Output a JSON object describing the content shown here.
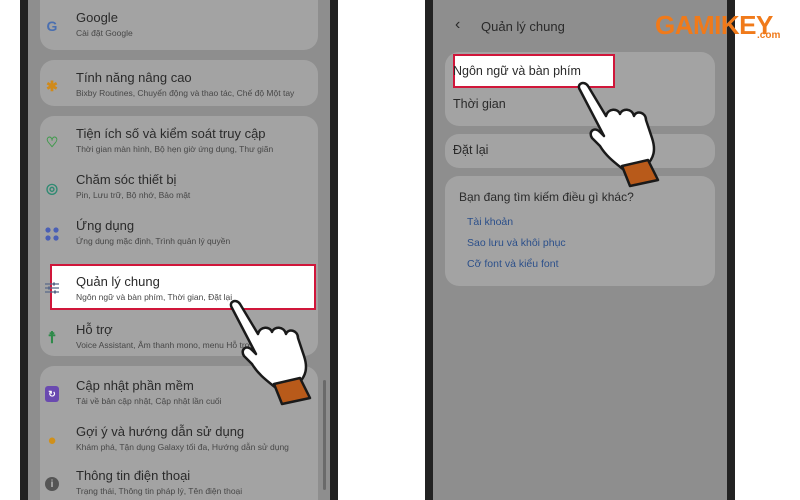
{
  "left_screen": {
    "items": [
      {
        "title": "Google",
        "sub": "Cài đặt Google",
        "icon": "google-icon",
        "color": "#4a6fb0"
      },
      {
        "title": "Tính năng nâng cao",
        "sub": "Bixby Routines, Chuyển động và thao tác, Chế độ Một tay",
        "icon": "gear-icon",
        "color": "#d08a1a"
      },
      {
        "title": "Tiện ích số và kiểm soát truy cập",
        "sub": "Thời gian màn hình, Bộ hẹn giờ ứng dụng, Thư giãn",
        "icon": "wellbeing-icon",
        "color": "#3e9a4a"
      },
      {
        "title": "Chăm sóc thiết bị",
        "sub": "Pin, Lưu trữ, Bộ nhớ, Bảo mật",
        "icon": "device-care-icon",
        "color": "#2f8a72"
      },
      {
        "title": "Ứng dụng",
        "sub": "Ứng dụng mặc định, Trình quản lý quyền",
        "icon": "apps-icon",
        "color": "#4a5fb5"
      },
      {
        "title": "Quản lý chung",
        "sub": "Ngôn ngữ và bàn phím, Thời gian, Đặt lại",
        "icon": "sliders-icon",
        "color": "#5a6a8a"
      },
      {
        "title": "Hỗ trợ",
        "sub": "Voice Assistant, Âm thanh mono, menu Hỗ trợ",
        "icon": "accessibility-icon",
        "color": "#2f8a4a"
      },
      {
        "title": "Cập nhật phần mềm",
        "sub": "Tải về bản cập nhật, Cập nhật lần cuối",
        "icon": "update-icon",
        "color": "#6a4ab0"
      },
      {
        "title": "Gợi ý và hướng dẫn sử dụng",
        "sub": "Khám phá, Tận dụng Galaxy tối đa, Hướng dẫn sử dụng",
        "icon": "bulb-icon",
        "color": "#d0901a"
      },
      {
        "title": "Thông tin điện thoại",
        "sub": "Trạng thái, Thông tin pháp lý, Tên điện thoại",
        "icon": "info-icon",
        "color": "#555555"
      }
    ]
  },
  "right_screen": {
    "header_title": "Quản lý chung",
    "items": [
      "Ngôn ngữ và bàn phím",
      "Thời gian",
      "Đặt lại"
    ],
    "suggest_title": "Bạn đang tìm kiếm điều gì khác?",
    "links": [
      "Tài khoản",
      "Sao lưu và khôi phục",
      "Cỡ font và kiểu font"
    ]
  },
  "logo": {
    "text": "GAMIKEY",
    "suffix": ".com",
    "color": "#f07a1a"
  }
}
